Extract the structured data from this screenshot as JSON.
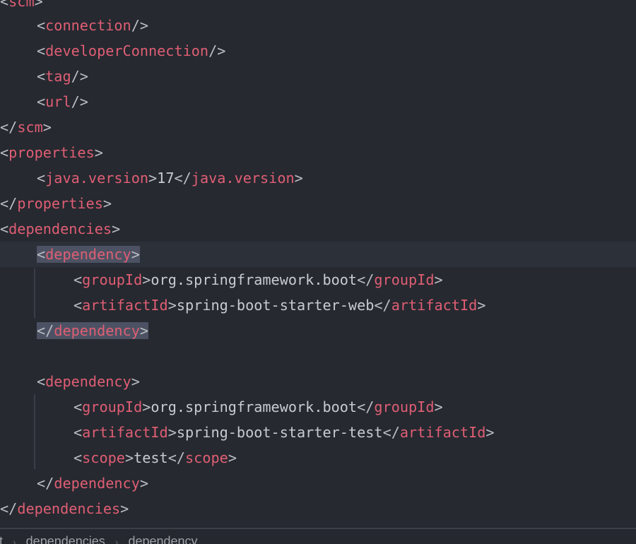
{
  "code": {
    "scm_open": "scm",
    "connection": "connection",
    "developerConnection": "developerConnection",
    "tag": "tag",
    "url": "url",
    "properties": "properties",
    "java_version_tag": "java.version",
    "java_version_value": "17",
    "dependencies": "dependencies",
    "dependency": "dependency",
    "groupId": "groupId",
    "artifactId": "artifactId",
    "scope": "scope",
    "dep1_group": "org.springframework.boot",
    "dep1_artifact": "spring-boot-starter-web",
    "dep2_group": "org.springframework.boot",
    "dep2_artifact": "spring-boot-starter-test",
    "dep2_scope": "test"
  },
  "breadcrumbs": {
    "items": [
      "rt",
      "dependencies",
      "dependency"
    ],
    "separator": "›"
  },
  "colors": {
    "background": "#262930",
    "tag": "#e05e74",
    "punctuation": "#bbbec4",
    "match_highlight": "#4c5263"
  }
}
